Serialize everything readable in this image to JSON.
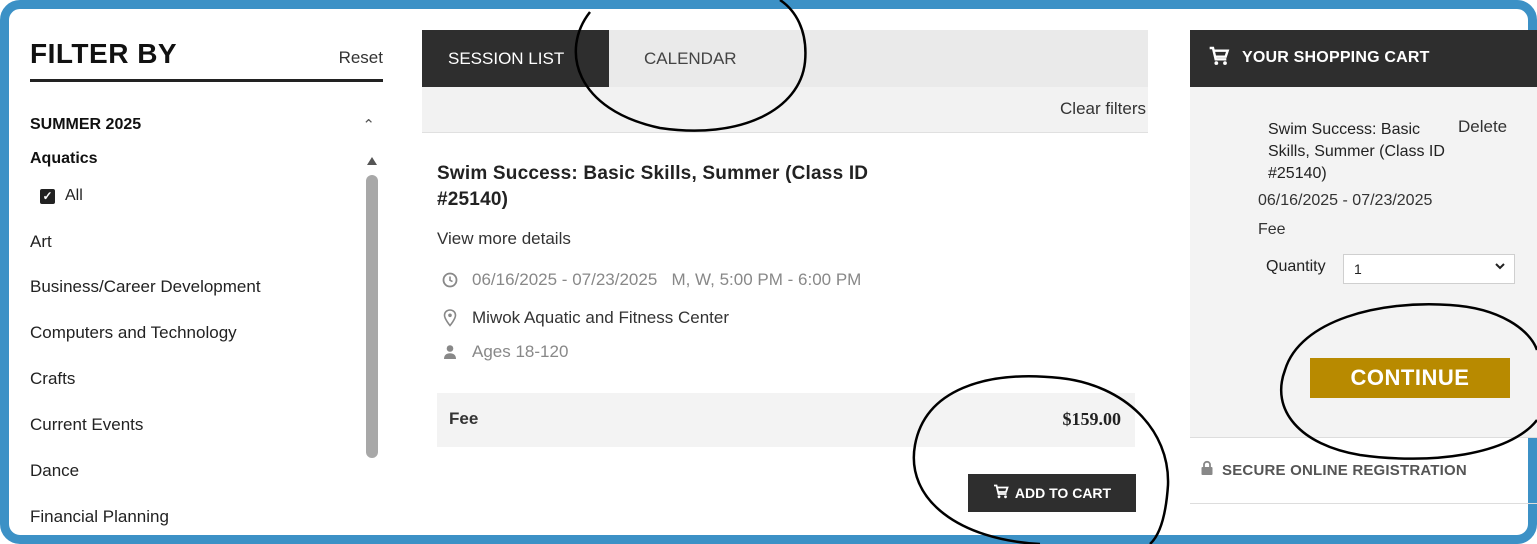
{
  "sidebar": {
    "title": "FILTER BY",
    "reset_label": "Reset",
    "season_label": "SUMMER 2025",
    "selected_category": "Aquatics",
    "all_label": "All",
    "categories": [
      "Art",
      "Business/Career Development",
      "Computers and Technology",
      "Crafts",
      "Current Events",
      "Dance",
      "Financial Planning"
    ]
  },
  "tabs": {
    "session_list": "SESSION LIST",
    "calendar": "CALENDAR"
  },
  "filters": {
    "clear_label": "Clear filters"
  },
  "session": {
    "title": "Swim Success: Basic Skills, Summer (Class ID #25140)",
    "details_link": "View more details",
    "schedule": "06/16/2025 - 07/23/2025   M, W, 5:00 PM - 6:00 PM",
    "location": "Miwok Aquatic and Fitness Center",
    "ages": "Ages 18-120",
    "fee_label": "Fee",
    "fee_amount": "$159.00",
    "add_to_cart_label": "ADD TO CART"
  },
  "cart": {
    "title": "YOUR SHOPPING CART",
    "item_name": "Swim Success: Basic Skills, Summer (Class ID #25140)",
    "delete_label": "Delete",
    "dates": "06/16/2025 - 07/23/2025",
    "fee_label": "Fee",
    "quantity_label": "Quantity",
    "quantity_value": "1",
    "continue_label": "CONTINUE",
    "secure_label": "SECURE ONLINE REGISTRATION"
  },
  "colors": {
    "frame_border": "#3c91c6",
    "dark_bar": "#2e2e2e",
    "continue_gold": "#b88a00"
  }
}
